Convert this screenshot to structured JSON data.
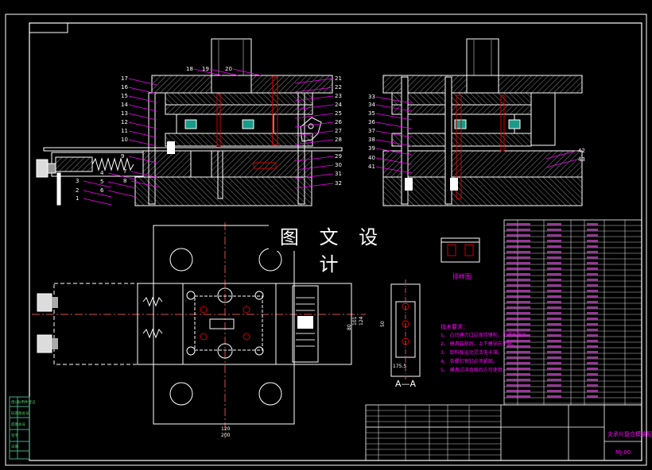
{
  "watermark_text": "图 文 设 计",
  "section_label": "A—A",
  "detail_label": "排样图",
  "part_numbers_left": [
    "17",
    "16",
    "15",
    "14",
    "13",
    "12",
    "11",
    "10",
    "9",
    "1",
    "2",
    "3",
    "4",
    "5",
    "6",
    "7",
    "8",
    "18",
    "19",
    "20"
  ],
  "part_numbers_right_of_left_view": [
    "21",
    "22",
    "23",
    "24",
    "25",
    "26",
    "27",
    "28",
    "29",
    "30",
    "31",
    "32"
  ],
  "part_numbers_right_view": [
    "33",
    "34",
    "35",
    "36",
    "37",
    "38",
    "39",
    "40",
    "41",
    "42",
    "43"
  ],
  "dimensions": [
    "120",
    "200",
    "175.5",
    "50",
    "80",
    "101",
    "124"
  ],
  "technical_requirements_title": "技术要求：",
  "technical_requirements": [
    "1、 凸凹模刃口应保持锋利，不得有崩刃。",
    "2、 模具装配后，上下模导向平稳。",
    "3、 卸料板运动灵活无卡滞。",
    "4、 各螺钉销钉必须紧固。",
    "5、 模具试冲合格后方可使用。"
  ],
  "drawing_title": "支承片复合模装配图",
  "drawing_number": "MJ-00",
  "left_side_labels": [
    "借(通)用件登记",
    "旧底图总号",
    "底图总号",
    "签字",
    "日期"
  ],
  "colors": {
    "background": "#000000",
    "outline": "#ffffff",
    "hatch": "#888888",
    "section": "#cc0000",
    "leader": "#ff00ff",
    "centerline": "#d05050",
    "bolt": "#e6e6e6"
  }
}
